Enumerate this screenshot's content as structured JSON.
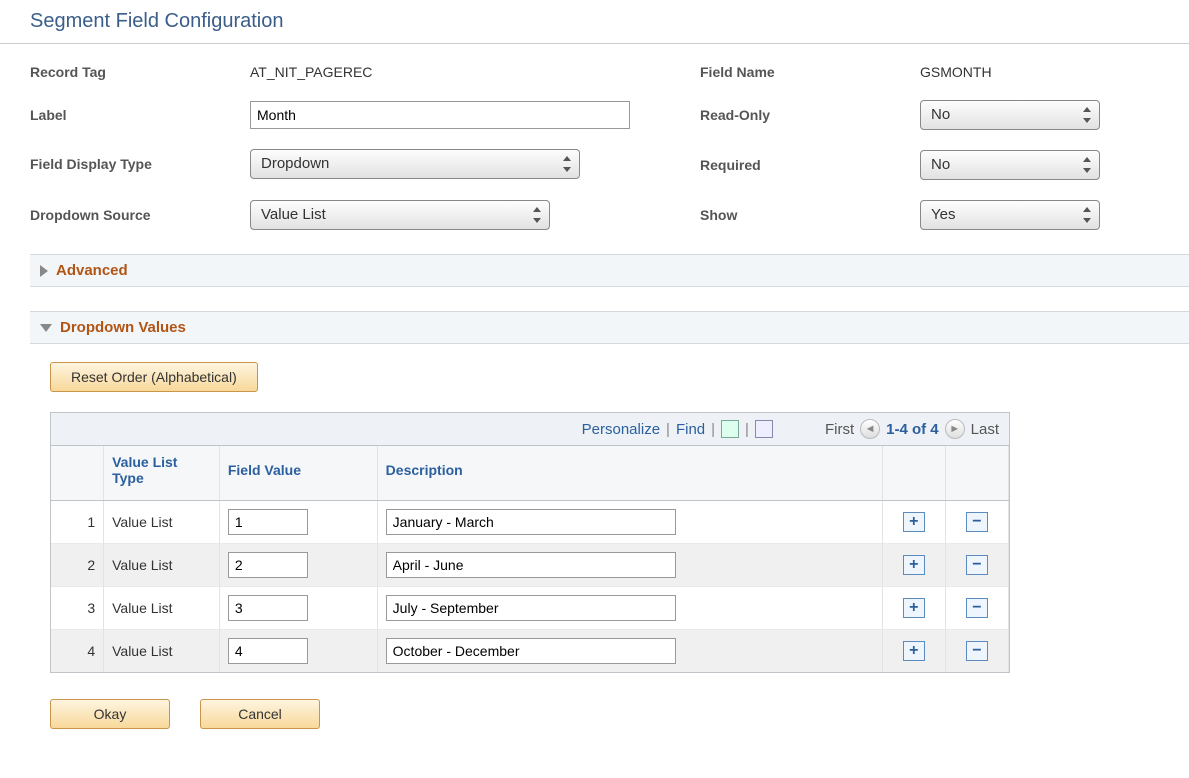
{
  "page_title": "Segment Field Configuration",
  "left": {
    "record_tag_label": "Record Tag",
    "record_tag_value": "AT_NIT_PAGEREC",
    "label_label": "Label",
    "label_value": "Month",
    "fdt_label": "Field Display Type",
    "fdt_value": "Dropdown",
    "dds_label": "Dropdown Source",
    "dds_value": "Value List"
  },
  "right": {
    "field_name_label": "Field Name",
    "field_name_value": "GSMONTH",
    "read_only_label": "Read-Only",
    "read_only_value": "No",
    "required_label": "Required",
    "required_value": "No",
    "show_label": "Show",
    "show_value": "Yes"
  },
  "section_advanced": "Advanced",
  "section_dropdown": "Dropdown Values",
  "reset_btn": "Reset Order (Alphabetical)",
  "gridnav": {
    "personalize": "Personalize",
    "find": "Find",
    "first": "First",
    "range": "1-4 of 4",
    "last": "Last"
  },
  "cols": {
    "n": "",
    "vlt": "Value List Type",
    "fv": "Field Value",
    "desc": "Description"
  },
  "rows": [
    {
      "n": "1",
      "vlt": "Value List",
      "fv": "1",
      "desc": "January - March"
    },
    {
      "n": "2",
      "vlt": "Value List",
      "fv": "2",
      "desc": "April - June"
    },
    {
      "n": "3",
      "vlt": "Value List",
      "fv": "3",
      "desc": "July - September"
    },
    {
      "n": "4",
      "vlt": "Value List",
      "fv": "4",
      "desc": "October - December"
    }
  ],
  "footer": {
    "ok": "Okay",
    "cancel": "Cancel"
  }
}
